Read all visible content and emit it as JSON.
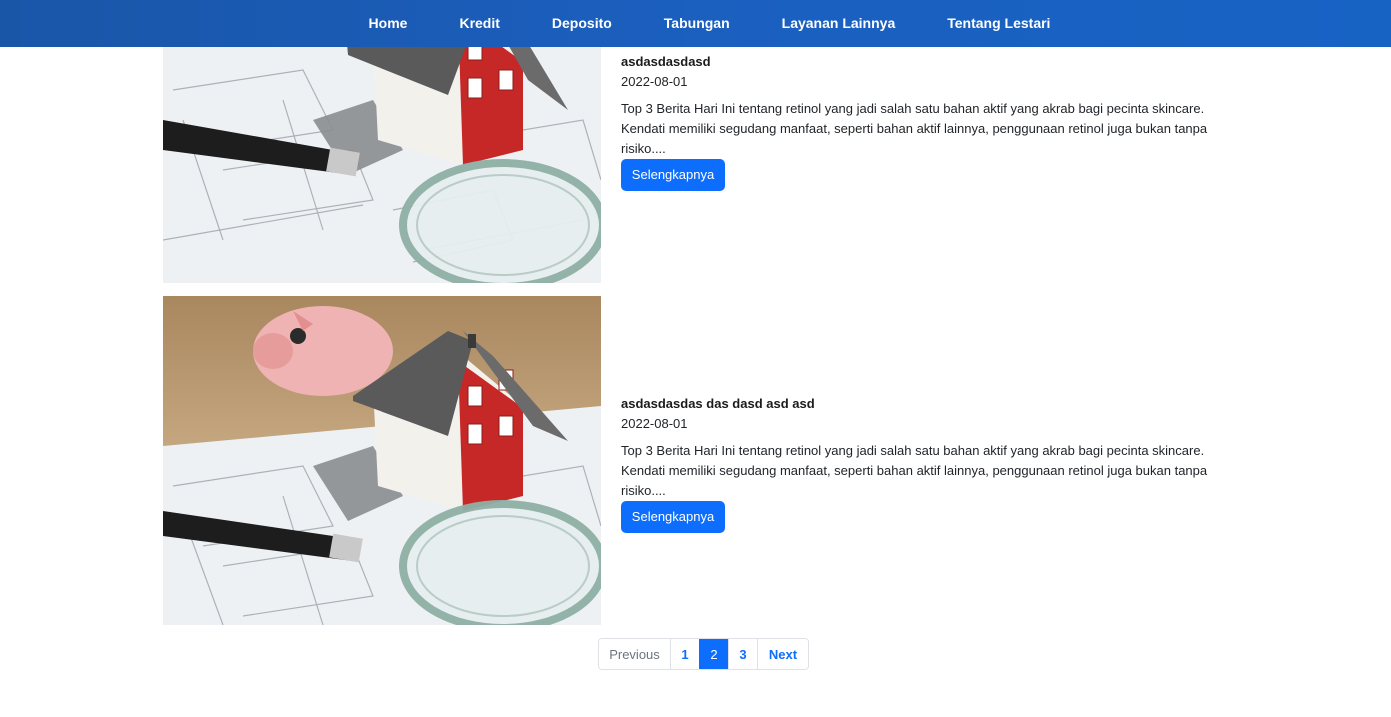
{
  "nav": {
    "items": [
      {
        "label": "Home"
      },
      {
        "label": "Kredit"
      },
      {
        "label": "Deposito"
      },
      {
        "label": "Tabungan"
      },
      {
        "label": "Layanan Lainnya"
      },
      {
        "label": "Tentang Lestari"
      }
    ]
  },
  "articles": [
    {
      "title": "asdasdasdasd",
      "date": "2022-08-01",
      "excerpt": "Top 3 Berita Hari Ini tentang retinol yang jadi salah satu bahan aktif yang akrab bagi pecinta skincare. Kendati memiliki segudang manfaat, seperti bahan aktif lainnya, penggunaan retinol juga bukan tanpa risiko....",
      "button_label": "Selengkapnya"
    },
    {
      "title": "asdasdasdas das dasd asd asd",
      "date": "2022-08-01",
      "excerpt": "Top 3 Berita Hari Ini tentang retinol yang jadi salah satu bahan aktif yang akrab bagi pecinta skincare. Kendati memiliki segudang manfaat, seperti bahan aktif lainnya, penggunaan retinol juga bukan tanpa risiko....",
      "button_label": "Selengkapnya"
    }
  ],
  "pagination": {
    "previous": "Previous",
    "pages": [
      "1",
      "2",
      "3"
    ],
    "active_page": "2",
    "next": "Next"
  },
  "colors": {
    "nav_bg": "#1b5fbf",
    "primary": "#0d6efd",
    "house_roof": "#5a5a5a",
    "house_wall_red": "#c62828"
  }
}
